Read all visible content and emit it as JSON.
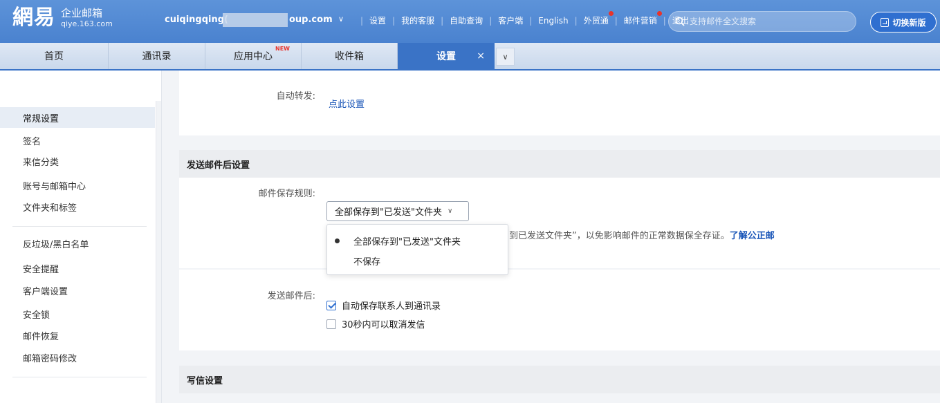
{
  "header": {
    "logo_glyph": "網易",
    "logo_name": "企业邮箱",
    "logo_domain": "qiye.163.com",
    "account_prefix": "cuiqingqing(",
    "account_suffix": "oup.com",
    "account_caret": "∨",
    "links": [
      "设置",
      "我的客服",
      "自助查询",
      "客户端",
      "English",
      "外贸通",
      "邮件营销",
      "退出"
    ],
    "search_placeholder": "支持邮件全文搜索",
    "switch_label": "切换新版"
  },
  "tabs": [
    {
      "label": "首页"
    },
    {
      "label": "通讯录"
    },
    {
      "label": "应用中心",
      "badge": "NEW"
    },
    {
      "label": "收件箱"
    },
    {
      "label": "设置",
      "close": "×"
    }
  ],
  "tab_more": "∨",
  "sidebar": {
    "items": [
      "常规设置",
      "签名",
      "来信分类",
      "账号与邮箱中心",
      "文件夹和标签",
      "反垃圾/黑白名单",
      "安全提醒",
      "客户端设置",
      "安全锁",
      "邮件恢复",
      "邮箱密码修改"
    ]
  },
  "main": {
    "forward_label": "自动转发:",
    "forward_link": "点此设置",
    "after_send_title": "发送邮件后设置",
    "save_rule_label": "邮件保存规则:",
    "save_rule_value": "全部保存到\"已发送\"文件夹",
    "save_rule_options": [
      "全部保存到\"已发送\"文件夹",
      "不保存"
    ],
    "hint_text": "到已发送文件夹”，以免影响邮件的正常数据保全存证。",
    "hint_link": "了解公正邮",
    "after_send_label": "发送邮件后:",
    "checkbox_1": "自动保存联系人到通讯录",
    "checkbox_2": "30秒内可以取消发信",
    "compose_title": "写信设置"
  },
  "colors": {
    "header_blue": "#4a82cf",
    "tab_active": "#3a73c6",
    "link_blue": "#1a56b8",
    "badge_red": "#e8342c"
  }
}
